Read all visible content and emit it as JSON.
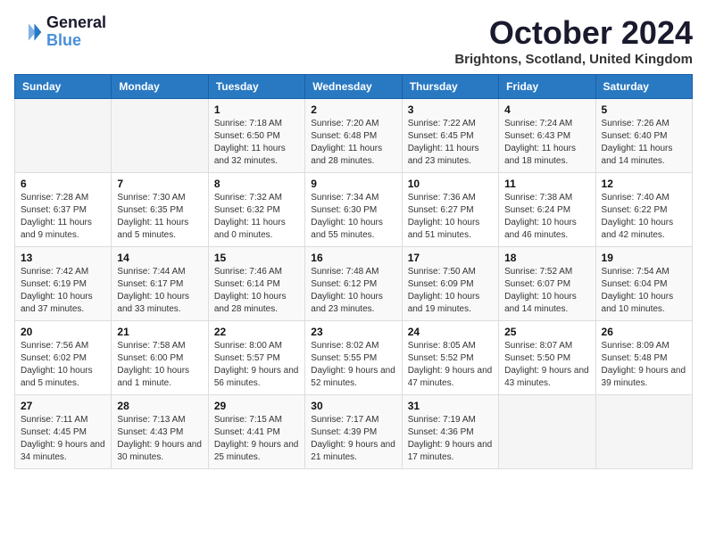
{
  "logo": {
    "line1": "General",
    "line2": "Blue"
  },
  "title": "October 2024",
  "location": "Brightons, Scotland, United Kingdom",
  "headers": [
    "Sunday",
    "Monday",
    "Tuesday",
    "Wednesday",
    "Thursday",
    "Friday",
    "Saturday"
  ],
  "weeks": [
    [
      {
        "day": "",
        "sunrise": "",
        "sunset": "",
        "daylight": ""
      },
      {
        "day": "",
        "sunrise": "",
        "sunset": "",
        "daylight": ""
      },
      {
        "day": "1",
        "sunrise": "Sunrise: 7:18 AM",
        "sunset": "Sunset: 6:50 PM",
        "daylight": "Daylight: 11 hours and 32 minutes."
      },
      {
        "day": "2",
        "sunrise": "Sunrise: 7:20 AM",
        "sunset": "Sunset: 6:48 PM",
        "daylight": "Daylight: 11 hours and 28 minutes."
      },
      {
        "day": "3",
        "sunrise": "Sunrise: 7:22 AM",
        "sunset": "Sunset: 6:45 PM",
        "daylight": "Daylight: 11 hours and 23 minutes."
      },
      {
        "day": "4",
        "sunrise": "Sunrise: 7:24 AM",
        "sunset": "Sunset: 6:43 PM",
        "daylight": "Daylight: 11 hours and 18 minutes."
      },
      {
        "day": "5",
        "sunrise": "Sunrise: 7:26 AM",
        "sunset": "Sunset: 6:40 PM",
        "daylight": "Daylight: 11 hours and 14 minutes."
      }
    ],
    [
      {
        "day": "6",
        "sunrise": "Sunrise: 7:28 AM",
        "sunset": "Sunset: 6:37 PM",
        "daylight": "Daylight: 11 hours and 9 minutes."
      },
      {
        "day": "7",
        "sunrise": "Sunrise: 7:30 AM",
        "sunset": "Sunset: 6:35 PM",
        "daylight": "Daylight: 11 hours and 5 minutes."
      },
      {
        "day": "8",
        "sunrise": "Sunrise: 7:32 AM",
        "sunset": "Sunset: 6:32 PM",
        "daylight": "Daylight: 11 hours and 0 minutes."
      },
      {
        "day": "9",
        "sunrise": "Sunrise: 7:34 AM",
        "sunset": "Sunset: 6:30 PM",
        "daylight": "Daylight: 10 hours and 55 minutes."
      },
      {
        "day": "10",
        "sunrise": "Sunrise: 7:36 AM",
        "sunset": "Sunset: 6:27 PM",
        "daylight": "Daylight: 10 hours and 51 minutes."
      },
      {
        "day": "11",
        "sunrise": "Sunrise: 7:38 AM",
        "sunset": "Sunset: 6:24 PM",
        "daylight": "Daylight: 10 hours and 46 minutes."
      },
      {
        "day": "12",
        "sunrise": "Sunrise: 7:40 AM",
        "sunset": "Sunset: 6:22 PM",
        "daylight": "Daylight: 10 hours and 42 minutes."
      }
    ],
    [
      {
        "day": "13",
        "sunrise": "Sunrise: 7:42 AM",
        "sunset": "Sunset: 6:19 PM",
        "daylight": "Daylight: 10 hours and 37 minutes."
      },
      {
        "day": "14",
        "sunrise": "Sunrise: 7:44 AM",
        "sunset": "Sunset: 6:17 PM",
        "daylight": "Daylight: 10 hours and 33 minutes."
      },
      {
        "day": "15",
        "sunrise": "Sunrise: 7:46 AM",
        "sunset": "Sunset: 6:14 PM",
        "daylight": "Daylight: 10 hours and 28 minutes."
      },
      {
        "day": "16",
        "sunrise": "Sunrise: 7:48 AM",
        "sunset": "Sunset: 6:12 PM",
        "daylight": "Daylight: 10 hours and 23 minutes."
      },
      {
        "day": "17",
        "sunrise": "Sunrise: 7:50 AM",
        "sunset": "Sunset: 6:09 PM",
        "daylight": "Daylight: 10 hours and 19 minutes."
      },
      {
        "day": "18",
        "sunrise": "Sunrise: 7:52 AM",
        "sunset": "Sunset: 6:07 PM",
        "daylight": "Daylight: 10 hours and 14 minutes."
      },
      {
        "day": "19",
        "sunrise": "Sunrise: 7:54 AM",
        "sunset": "Sunset: 6:04 PM",
        "daylight": "Daylight: 10 hours and 10 minutes."
      }
    ],
    [
      {
        "day": "20",
        "sunrise": "Sunrise: 7:56 AM",
        "sunset": "Sunset: 6:02 PM",
        "daylight": "Daylight: 10 hours and 5 minutes."
      },
      {
        "day": "21",
        "sunrise": "Sunrise: 7:58 AM",
        "sunset": "Sunset: 6:00 PM",
        "daylight": "Daylight: 10 hours and 1 minute."
      },
      {
        "day": "22",
        "sunrise": "Sunrise: 8:00 AM",
        "sunset": "Sunset: 5:57 PM",
        "daylight": "Daylight: 9 hours and 56 minutes."
      },
      {
        "day": "23",
        "sunrise": "Sunrise: 8:02 AM",
        "sunset": "Sunset: 5:55 PM",
        "daylight": "Daylight: 9 hours and 52 minutes."
      },
      {
        "day": "24",
        "sunrise": "Sunrise: 8:05 AM",
        "sunset": "Sunset: 5:52 PM",
        "daylight": "Daylight: 9 hours and 47 minutes."
      },
      {
        "day": "25",
        "sunrise": "Sunrise: 8:07 AM",
        "sunset": "Sunset: 5:50 PM",
        "daylight": "Daylight: 9 hours and 43 minutes."
      },
      {
        "day": "26",
        "sunrise": "Sunrise: 8:09 AM",
        "sunset": "Sunset: 5:48 PM",
        "daylight": "Daylight: 9 hours and 39 minutes."
      }
    ],
    [
      {
        "day": "27",
        "sunrise": "Sunrise: 7:11 AM",
        "sunset": "Sunset: 4:45 PM",
        "daylight": "Daylight: 9 hours and 34 minutes."
      },
      {
        "day": "28",
        "sunrise": "Sunrise: 7:13 AM",
        "sunset": "Sunset: 4:43 PM",
        "daylight": "Daylight: 9 hours and 30 minutes."
      },
      {
        "day": "29",
        "sunrise": "Sunrise: 7:15 AM",
        "sunset": "Sunset: 4:41 PM",
        "daylight": "Daylight: 9 hours and 25 minutes."
      },
      {
        "day": "30",
        "sunrise": "Sunrise: 7:17 AM",
        "sunset": "Sunset: 4:39 PM",
        "daylight": "Daylight: 9 hours and 21 minutes."
      },
      {
        "day": "31",
        "sunrise": "Sunrise: 7:19 AM",
        "sunset": "Sunset: 4:36 PM",
        "daylight": "Daylight: 9 hours and 17 minutes."
      },
      {
        "day": "",
        "sunrise": "",
        "sunset": "",
        "daylight": ""
      },
      {
        "day": "",
        "sunrise": "",
        "sunset": "",
        "daylight": ""
      }
    ]
  ]
}
